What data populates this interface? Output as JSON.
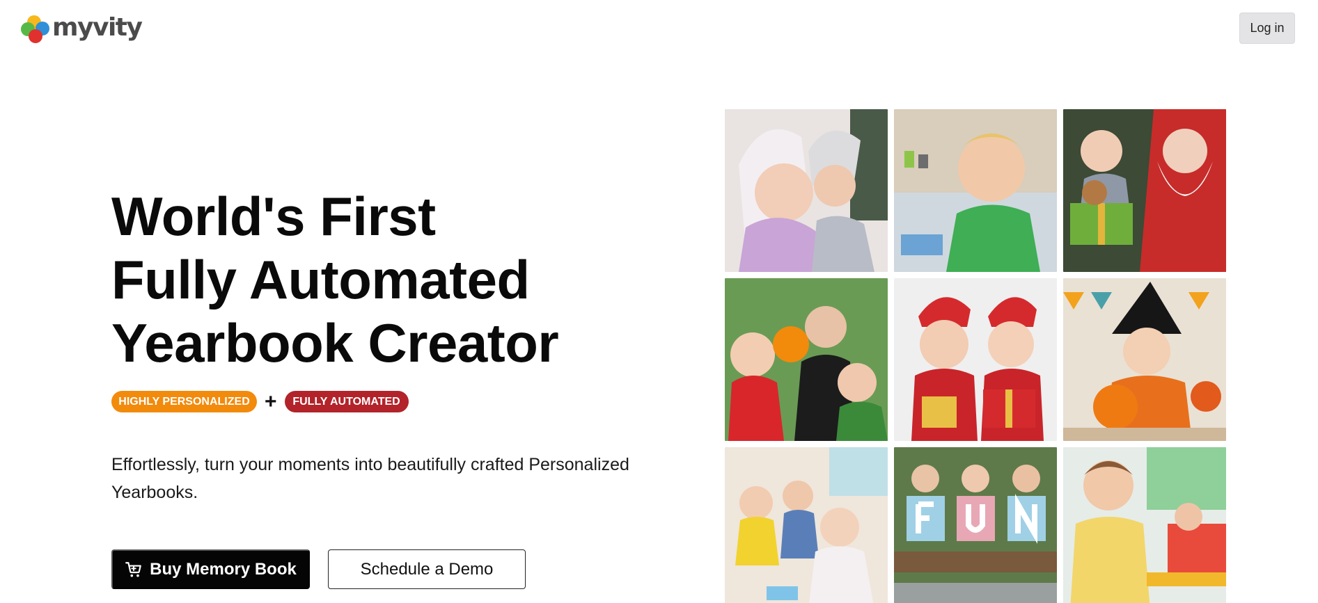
{
  "header": {
    "logo_text": "myvity",
    "login_label": "Log in"
  },
  "hero": {
    "headline": [
      "World's First",
      "Fully Automated",
      "Yearbook Creator"
    ],
    "badges": [
      {
        "label": "HIGHLY PERSONALIZED",
        "color": "#f28a0c"
      },
      {
        "label": "FULLY AUTOMATED",
        "color": "#b2232a"
      }
    ],
    "plus": "+",
    "description": "Effortlessly, turn your moments into beautifully crafted Personalized Yearbooks.",
    "buttons": {
      "buy_label": "Buy Memory Book",
      "demo_label": "Schedule a Demo"
    }
  },
  "photos": [
    {
      "icon": "children-costume-photo"
    },
    {
      "icon": "child-painting-photo"
    },
    {
      "icon": "child-with-santa-photo"
    },
    {
      "icon": "halloween-kids-photo"
    },
    {
      "icon": "christmas-kids-photo"
    },
    {
      "icon": "witch-hat-child-photo"
    },
    {
      "icon": "kids-playing-photo"
    },
    {
      "icon": "fun-letters-kids-photo"
    },
    {
      "icon": "classroom-boy-photo"
    }
  ],
  "colors": {
    "accent_orange": "#f28a0c",
    "accent_red": "#b2232a",
    "primary_button": "#050505"
  }
}
